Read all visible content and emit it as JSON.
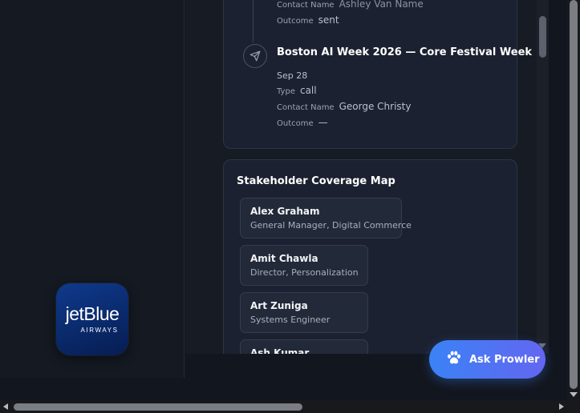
{
  "activity": {
    "previous": {
      "contact_name_label": "Contact Name",
      "contact_name_value": "Ashley Van Name",
      "outcome_label": "Outcome",
      "outcome_value": "sent"
    },
    "current": {
      "icon": "send-icon",
      "title": "Boston AI Week 2026 — Core Festival Week",
      "date": "Sep 28",
      "type_label": "Type",
      "type_value": "call",
      "contact_name_label": "Contact Name",
      "contact_name_value": "George Christy",
      "outcome_label": "Outcome",
      "outcome_value": "—"
    }
  },
  "stakeholder_map": {
    "title": "Stakeholder Coverage Map",
    "people": [
      {
        "name": "Alex Graham",
        "role": "General Manager, Digital Commerce"
      },
      {
        "name": "Amit Chawla",
        "role": "Director, Personalization"
      },
      {
        "name": "Art Zuniga",
        "role": "Systems Engineer"
      },
      {
        "name": "Ash Kumar",
        "role": ""
      }
    ]
  },
  "logo": {
    "word": "jetBlue",
    "sub": "AIRWAYS",
    "color": "#0a2a6c"
  },
  "assistant": {
    "label": "Ask Prowler",
    "icon": "paw-icon"
  },
  "colors": {
    "accent_start": "#3b82f6",
    "accent_end": "#6366f1",
    "background": "#12161e",
    "card": "#1b2130"
  }
}
